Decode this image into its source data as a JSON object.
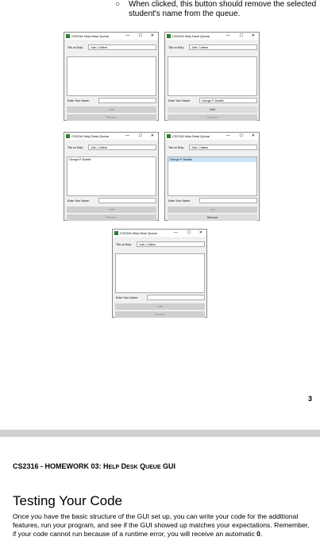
{
  "bullet": {
    "marker": "○",
    "text": "When clicked, this button should remove the selected student's name from the queue."
  },
  "window_common": {
    "title": "CS2316 Help Desk Queue",
    "min_glyph": "—",
    "max_glyph": "☐",
    "close_glyph": "✕",
    "tas_label": "TAs on Duty:",
    "tas_value": "Josh, Colleen",
    "enter_label": "Enter Your Name:",
    "add_label": "Add",
    "remove_label": "Remove"
  },
  "windows": [
    {
      "name_value": "",
      "list": [],
      "selected": -1,
      "add_enabled": false,
      "remove_enabled": false
    },
    {
      "name_value": "George P. Burdell",
      "list": [],
      "selected": -1,
      "add_enabled": true,
      "remove_enabled": false
    },
    {
      "name_value": "",
      "list": [
        "George P. Burdell"
      ],
      "selected": -1,
      "add_enabled": false,
      "remove_enabled": false
    },
    {
      "name_value": "",
      "list": [
        "George P. Burdell"
      ],
      "selected": 0,
      "add_enabled": false,
      "remove_enabled": true
    },
    {
      "name_value": "",
      "list": [],
      "selected": -1,
      "add_enabled": false,
      "remove_enabled": false
    }
  ],
  "page_number": "3",
  "doc_header": {
    "prefix": "CS2316 - HOMEWORK 03: ",
    "sc_h": "H",
    "sc_elp": "ELP",
    "sc_d": " D",
    "sc_esk": "ESK",
    "sc_q": " Q",
    "sc_ueue": "UEUE",
    "suffix": " GUI"
  },
  "section_heading": "Testing Your Code",
  "paragraph": {
    "text": "Once you have the basic structure of the GUI set up, you can write your code for the additional features, run your program, and see if the GUI showed up matches your expectations. Remember, if your code cannot run because of a runtime error, you will receive an automatic ",
    "bold": "0",
    "end": "."
  }
}
